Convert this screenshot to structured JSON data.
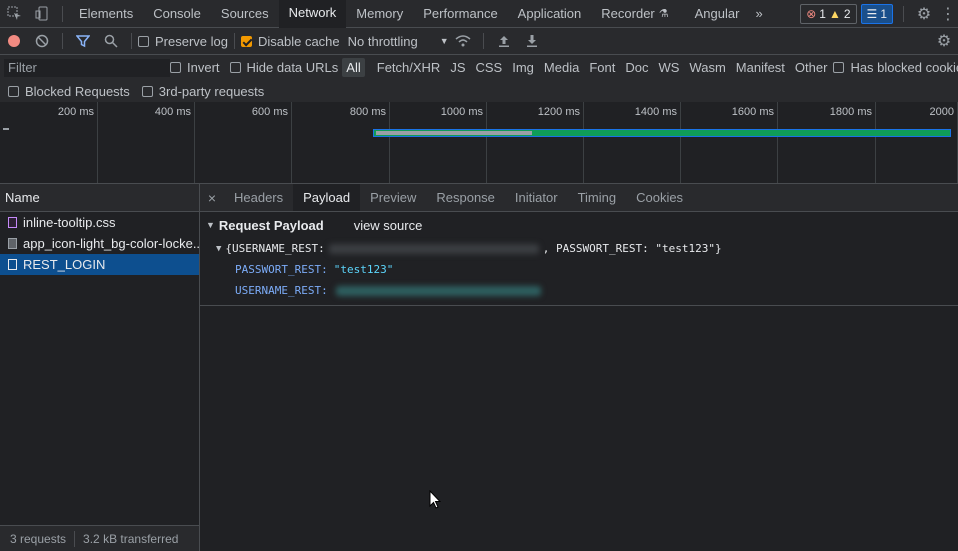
{
  "tabs": [
    "Elements",
    "Console",
    "Sources",
    "Network",
    "Memory",
    "Performance",
    "Application",
    "Recorder",
    "Angular"
  ],
  "recorder_icon": "flask-icon",
  "badges": {
    "errors": "1",
    "warnings": "2",
    "messages": "1"
  },
  "toolbar": {
    "preserve_log": "Preserve log",
    "disable_cache": "Disable cache",
    "throttling": "No throttling"
  },
  "filter": {
    "placeholder": "Filter",
    "invert": "Invert",
    "hide_data_urls": "Hide data URLs",
    "types": [
      "All",
      "Fetch/XHR",
      "JS",
      "CSS",
      "Img",
      "Media",
      "Font",
      "Doc",
      "WS",
      "Wasm",
      "Manifest",
      "Other"
    ],
    "has_blocked_cookies": "Has blocked cookies",
    "blocked_requests": "Blocked Requests",
    "third_party": "3rd-party requests"
  },
  "timeline": {
    "ticks": [
      "200 ms",
      "400 ms",
      "600 ms",
      "800 ms",
      "1000 ms",
      "1200 ms",
      "1400 ms",
      "1600 ms",
      "1800 ms",
      "2000"
    ]
  },
  "requests": {
    "header": "Name",
    "items": [
      "inline-tooltip.css",
      "app_icon-light_bg-color-locke...",
      "REST_LOGIN"
    ]
  },
  "status": {
    "requests": "3 requests",
    "transferred": "3.2 kB transferred"
  },
  "details": {
    "tabs": [
      "Headers",
      "Payload",
      "Preview",
      "Response",
      "Initiator",
      "Timing",
      "Cookies"
    ]
  },
  "payload": {
    "title": "Request Payload",
    "view_source": "view source",
    "summary_open": "{USERNAME_REST:",
    "summary_rest": ", PASSWORT_REST: \"test123\"}",
    "pw_key": "PASSWORT_REST:",
    "pw_val": "\"test123\"",
    "user_key": "USERNAME_REST:"
  },
  "colors": {
    "accent": "#1a73e8",
    "selected_row": "#0d4f8f",
    "waterfall_green": "#0f9d58"
  }
}
